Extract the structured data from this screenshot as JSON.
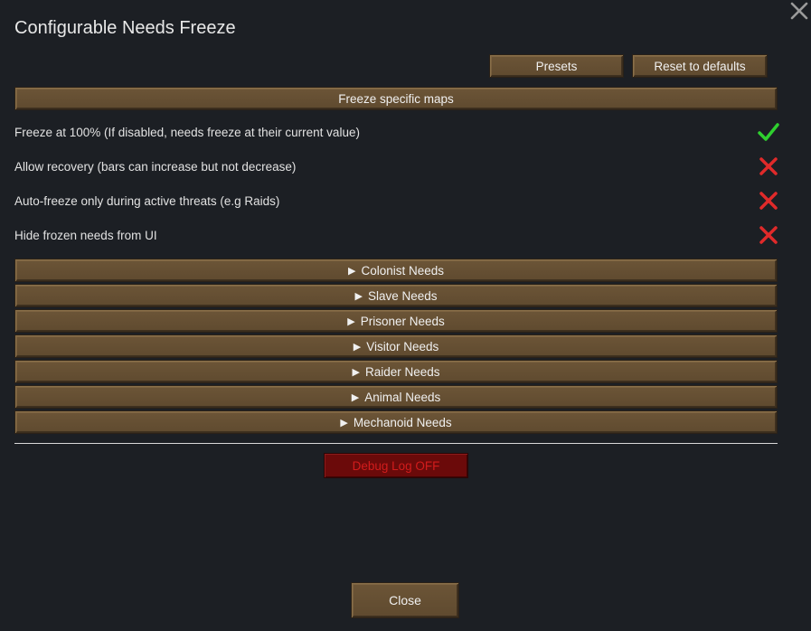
{
  "window": {
    "title": "Configurable Needs Freeze"
  },
  "toolbar": {
    "presets_label": "Presets",
    "reset_label": "Reset to defaults"
  },
  "freeze_maps_label": "Freeze specific maps",
  "settings": [
    {
      "label": "Freeze at 100% (If disabled, needs freeze at their current value)",
      "enabled": true,
      "icon": "checkmark-icon"
    },
    {
      "label": "Allow recovery (bars can increase but not decrease)",
      "enabled": false,
      "icon": "cross-icon"
    },
    {
      "label": "Auto-freeze only during active threats (e.g Raids)",
      "enabled": false,
      "icon": "cross-icon"
    },
    {
      "label": "Hide frozen needs from UI",
      "enabled": false,
      "icon": "cross-icon"
    }
  ],
  "sections": [
    {
      "label": "Colonist Needs"
    },
    {
      "label": "Slave Needs"
    },
    {
      "label": "Prisoner Needs"
    },
    {
      "label": "Visitor Needs"
    },
    {
      "label": "Raider Needs"
    },
    {
      "label": "Animal Needs"
    },
    {
      "label": "Mechanoid Needs"
    }
  ],
  "caret_glyph": "▶",
  "debug_label": "Debug Log OFF",
  "close_label": "Close",
  "colors": {
    "background": "#1c1f24",
    "wood": "#5f4a2f",
    "check": "#2fd02f",
    "cross": "#e02a2a",
    "debug_bg": "#6b0a0a",
    "debug_text": "#d21c1c"
  }
}
